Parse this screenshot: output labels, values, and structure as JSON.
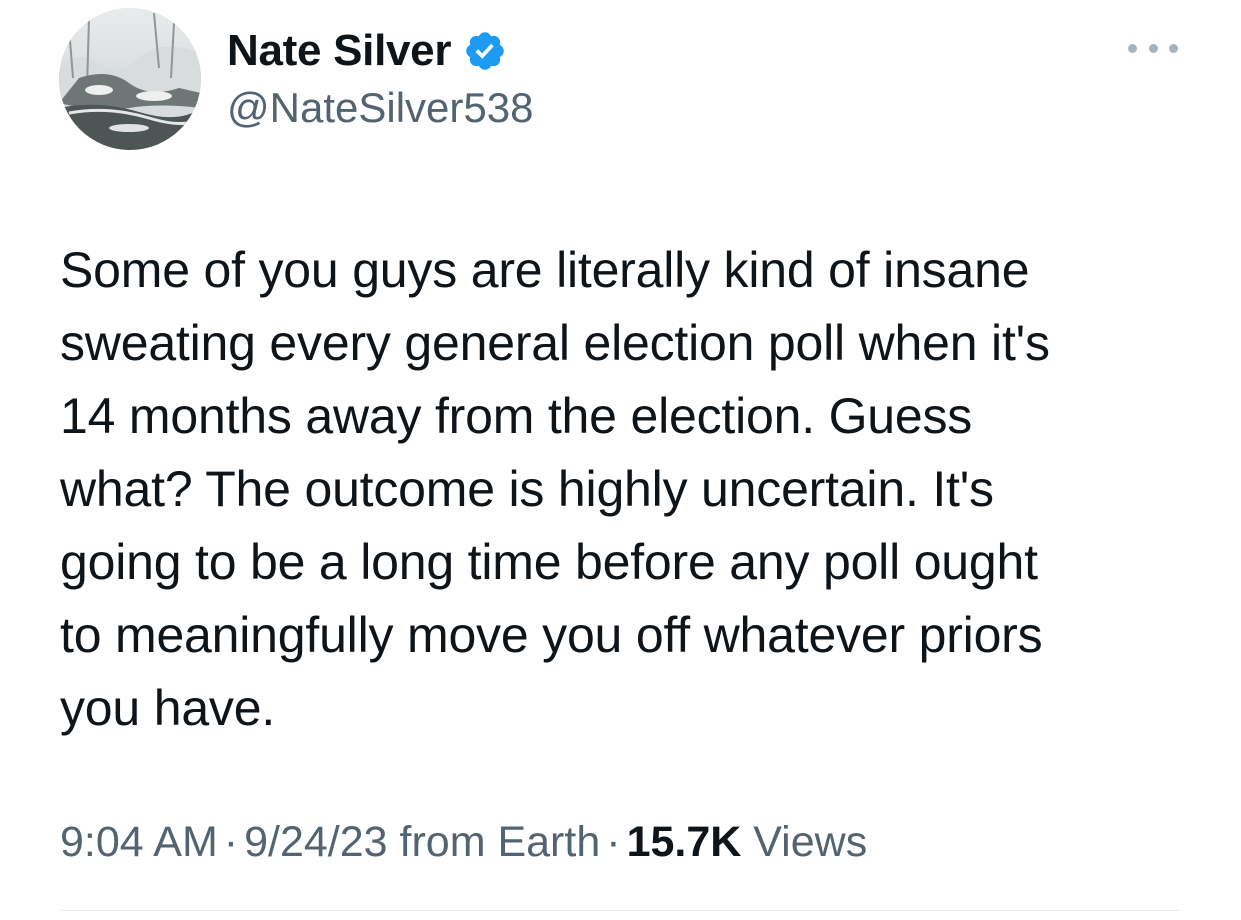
{
  "author": {
    "display_name": "Nate Silver",
    "handle": "@NateSilver538",
    "verified": true,
    "verified_color": "#1d9bf0"
  },
  "more_menu_icon": "more-horizontal-icon",
  "tweet": {
    "lines": [
      "Some of you guys are literally kind of insane",
      "sweating every general election poll when it's",
      "14 months away from the election. Guess",
      "what? The outcome is highly uncertain. It's",
      "going to be a long time before any poll ought",
      "to meaningfully move you off whatever priors",
      "you have."
    ]
  },
  "meta": {
    "time": "9:04 AM",
    "separator": "·",
    "date_source": "9/24/23 from Earth",
    "views_count": "15.7K",
    "views_label": "Views"
  },
  "colors": {
    "text_primary": "#0f1419",
    "text_secondary": "#536471"
  }
}
